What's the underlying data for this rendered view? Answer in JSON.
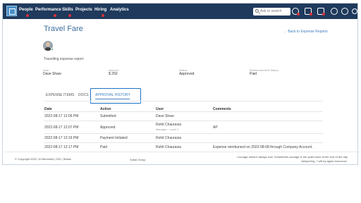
{
  "nav": {
    "items": [
      {
        "label": "People",
        "badge": true
      },
      {
        "label": "Performance",
        "badge": true
      },
      {
        "label": "Skills",
        "badge": true
      },
      {
        "label": "Projects",
        "badge": false
      },
      {
        "label": "Hiring",
        "badge": true
      },
      {
        "label": "Analytics",
        "badge": false
      }
    ],
    "search_placeholder": "Ask or search",
    "icons": [
      "settings-icon",
      "notifications-icon",
      "messages-icon",
      "help-icon",
      "user-menu-icon",
      "profile-icon"
    ]
  },
  "page": {
    "title": "Travel Fare",
    "back_link": "← Back to Expense Reports",
    "subtitle": "Travelling expense report"
  },
  "fields": {
    "user_label": "User",
    "user_value": "Dave Shaw",
    "amount_label": "Amount",
    "amount_value": "$ 250",
    "status_label": "Status",
    "status_value": "Approved",
    "reimb_label": "Reimbursement Status",
    "reimb_value": "Paid"
  },
  "tabs": {
    "items": [
      "EXPENSE ITEMS",
      "DOCS",
      "APPROVAL HISTORY"
    ],
    "active": "APPROVAL HISTORY"
  },
  "table": {
    "headers": [
      "Date",
      "Action",
      "User",
      "Comments"
    ],
    "rows": [
      {
        "date": "2022-08-17 12:06 PM",
        "action": "Submitted",
        "user": "Dave Shaw",
        "user_sub": "",
        "comment": ""
      },
      {
        "date": "2022-08-17 12:07 PM",
        "action": "Approved",
        "user": "Rohit Chaurasia",
        "user_sub": "Manager · Level 1",
        "comment": "AP"
      },
      {
        "date": "2022-08-17 12:16 PM",
        "action": "Payment Initiated",
        "user": "Rohit Chaurasia",
        "user_sub": "",
        "comment": ""
      },
      {
        "date": "2022-08-17 12:17 PM",
        "action": "Paid",
        "user": "Rohit Chaurasia",
        "user_sub": "",
        "comment": "Expense reimbursed on 2022-08-08 through Company Account."
      }
    ]
  },
  "footer": {
    "left": "© Copyright 2022, AI Mechinell  |  GDI  |  Status",
    "center": "Sobal Group",
    "right_line1": "Courage doesn't always roar. Sometimes courage is the quiet voice at the end of the day",
    "right_line2": "whispering, 'I will try again tomorrow.'"
  },
  "colors": {
    "nav_bg": "#1f3a5c",
    "accent": "#3e7fbf",
    "highlight_box": "#1e74c6",
    "badge": "#e0303a"
  }
}
